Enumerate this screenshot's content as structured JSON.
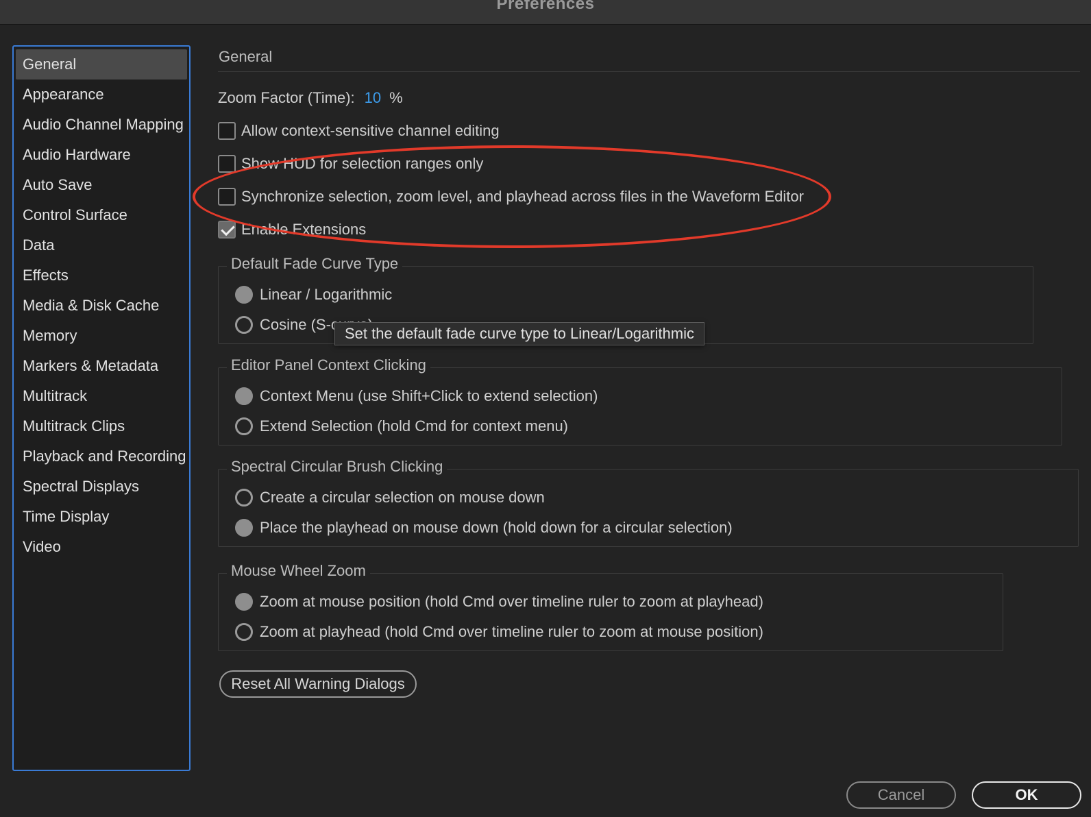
{
  "window": {
    "title": "Preferences"
  },
  "sidebar": {
    "items": [
      {
        "label": "General",
        "selected": true
      },
      {
        "label": "Appearance"
      },
      {
        "label": "Audio Channel Mapping"
      },
      {
        "label": "Audio Hardware"
      },
      {
        "label": "Auto Save"
      },
      {
        "label": "Control Surface"
      },
      {
        "label": "Data"
      },
      {
        "label": "Effects"
      },
      {
        "label": "Media & Disk Cache"
      },
      {
        "label": "Memory"
      },
      {
        "label": "Markers & Metadata"
      },
      {
        "label": "Multitrack"
      },
      {
        "label": "Multitrack Clips"
      },
      {
        "label": "Playback and Recording"
      },
      {
        "label": "Spectral Displays"
      },
      {
        "label": "Time Display"
      },
      {
        "label": "Video"
      }
    ]
  },
  "general": {
    "section_title": "General",
    "zoom_factor": {
      "label": "Zoom Factor (Time):",
      "value": "10",
      "unit": "%"
    },
    "checkboxes": [
      {
        "label": "Allow context-sensitive channel editing",
        "checked": false
      },
      {
        "label": "Show HUD for selection ranges only",
        "checked": false
      },
      {
        "label": "Synchronize selection, zoom level, and playhead across files in the Waveform Editor",
        "checked": false
      },
      {
        "label": "Enable Extensions",
        "checked": true
      }
    ],
    "fade_curve": {
      "legend": "Default Fade Curve Type",
      "options": [
        {
          "label": "Linear / Logarithmic",
          "selected": true
        },
        {
          "label": "Cosine (S-curve)",
          "selected": false
        }
      ]
    },
    "editor_context": {
      "legend": "Editor Panel Context Clicking",
      "options": [
        {
          "label": "Context Menu (use Shift+Click to extend selection)",
          "selected": true
        },
        {
          "label": "Extend Selection (hold Cmd for context menu)",
          "selected": false
        }
      ]
    },
    "spectral_brush": {
      "legend": "Spectral Circular Brush Clicking",
      "options": [
        {
          "label": "Create a circular selection on mouse down",
          "selected": false
        },
        {
          "label": "Place the playhead on mouse down (hold down for a circular selection)",
          "selected": true
        }
      ]
    },
    "mouse_wheel": {
      "legend": "Mouse Wheel Zoom",
      "options": [
        {
          "label": "Zoom at mouse position (hold Cmd over timeline ruler to zoom at playhead)",
          "selected": true
        },
        {
          "label": "Zoom at playhead (hold Cmd over timeline ruler to zoom at mouse position)",
          "selected": false
        }
      ]
    },
    "reset_button": "Reset All Warning Dialogs",
    "tooltip": "Set the default fade curve type to Linear/Logarithmic"
  },
  "footer": {
    "cancel": "Cancel",
    "ok": "OK"
  },
  "colors": {
    "accent": "#3a7bd5",
    "value_blue": "#3c9bea",
    "annotation_red": "#e23a2a"
  }
}
